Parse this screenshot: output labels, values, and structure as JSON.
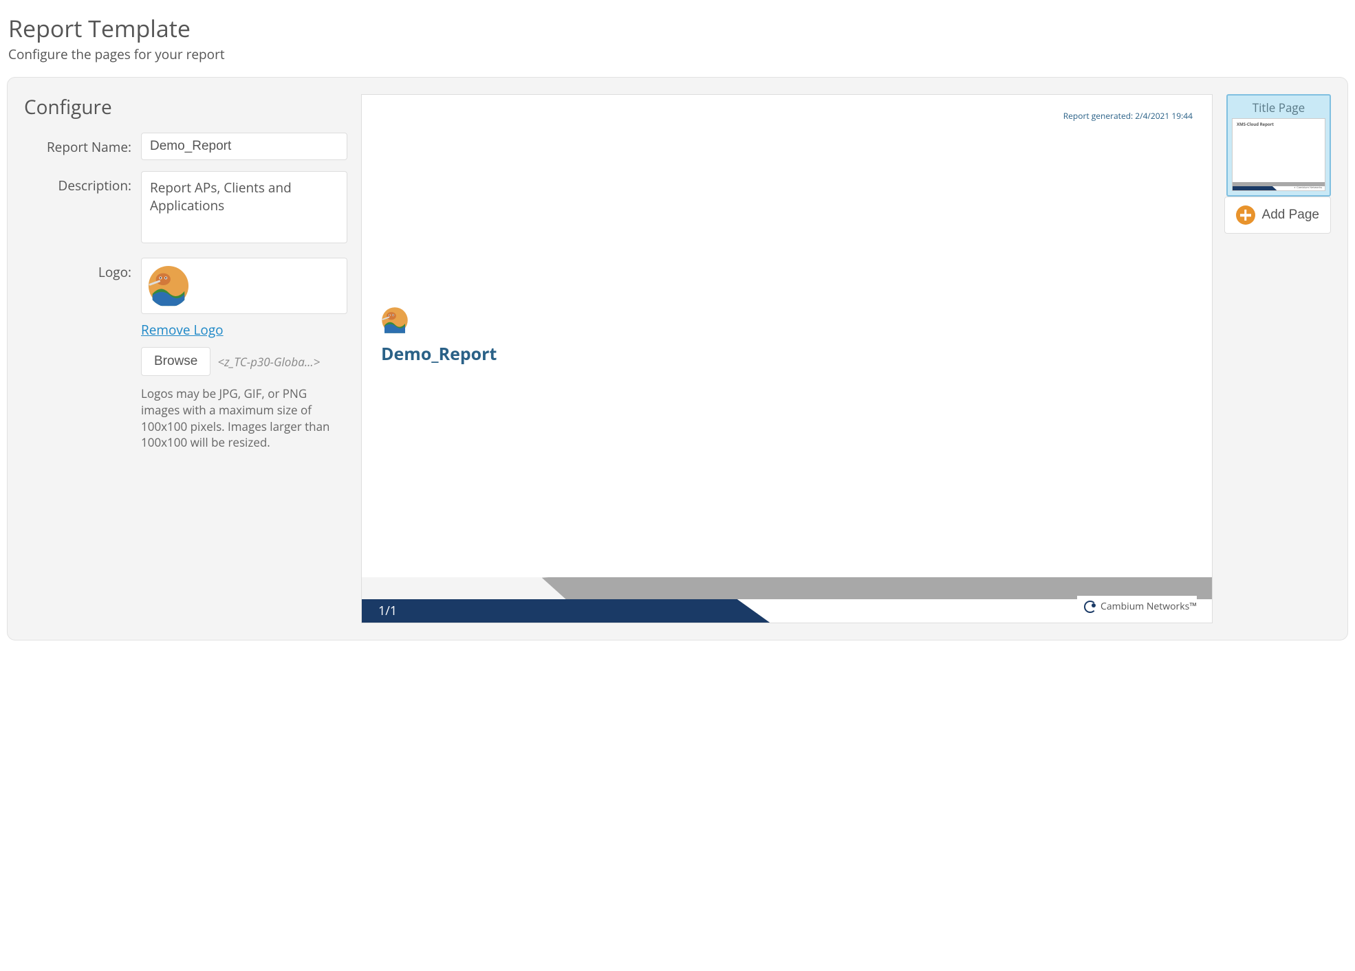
{
  "header": {
    "title": "Report Template",
    "subtitle": "Configure the pages for your report"
  },
  "configure": {
    "heading": "Configure",
    "labels": {
      "report_name": "Report Name:",
      "description": "Description:",
      "logo": "Logo:"
    },
    "report_name_value": "Demo_Report",
    "description_value": "Report APs, Clients and Applications",
    "remove_logo": "Remove Logo",
    "browse_label": "Browse",
    "file_name": "<z_TC-p30-Globa...>",
    "help_text": "Logos may be JPG, GIF, or PNG images with a maximum size of 100x100 pixels. Images larger than 100x100 will be resized."
  },
  "preview": {
    "generated_stamp": "Report generated: 2/4/2021 19:44",
    "title": "Demo_Report",
    "page_indicator": "1/1",
    "footer_brand": "Cambium Networks™"
  },
  "thumbnails": [
    {
      "label": "Title Page",
      "mini_label": "XMS-Cloud Report"
    }
  ],
  "add_page_label": "Add Page"
}
